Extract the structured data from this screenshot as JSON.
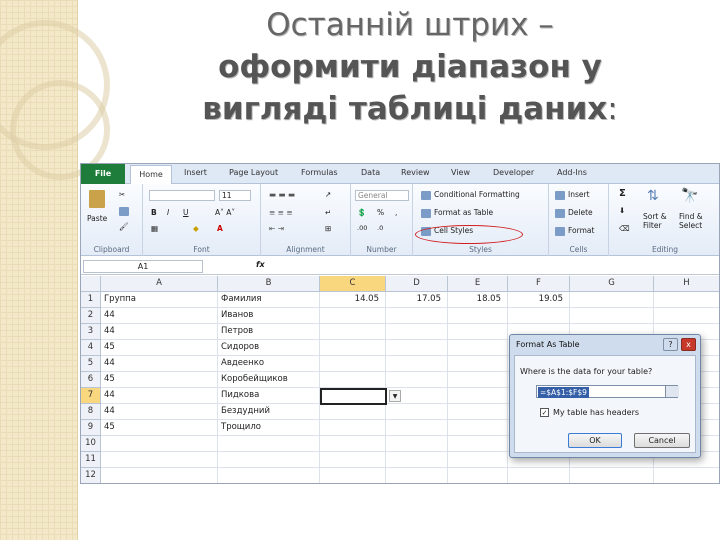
{
  "slide": {
    "title_line1": "Останній штрих –",
    "title_line2": "оформити діапазон у",
    "title_line3": "вигляді таблиці даних",
    "title_colon": ":"
  },
  "ribbon": {
    "tabs": [
      "File",
      "Home",
      "Insert",
      "Page Layout",
      "Formulas",
      "Data",
      "Review",
      "View",
      "Developer",
      "Add-Ins"
    ],
    "groups": [
      "Clipboard",
      "Font",
      "Alignment",
      "Number",
      "Styles",
      "Cells",
      "Editing"
    ],
    "paste": "Paste",
    "font_size": "11",
    "number_format": "General",
    "conditional_formatting": "Conditional Formatting",
    "format_as_table": "Format as Table",
    "cell_styles": "Cell Styles",
    "insert": "Insert",
    "delete": "Delete",
    "format": "Format",
    "sort_filter": "Sort & Filter",
    "find_select": "Find & Select",
    "sigma": "Σ",
    "percent": "%",
    "accent_oval": "#d02020"
  },
  "formula_bar": {
    "name_box": "A1",
    "fx": "fx"
  },
  "sheet": {
    "columns": [
      "A",
      "B",
      "C",
      "D",
      "E",
      "F",
      "G",
      "H"
    ],
    "row_numbers": [
      "1",
      "2",
      "3",
      "4",
      "5",
      "6",
      "7",
      "8",
      "9",
      "10",
      "11",
      "12"
    ],
    "header_row": [
      "Группа",
      "Фамилия",
      "14.05",
      "17.05",
      "18.05",
      "19.05"
    ],
    "rows": [
      [
        "44",
        "Иванов"
      ],
      [
        "44",
        "Петров"
      ],
      [
        "45",
        "Сидоров"
      ],
      [
        "44",
        "Авдеенко"
      ],
      [
        "45",
        "Коробейщиков"
      ],
      [
        "44",
        "Пидкова"
      ],
      [
        "44",
        "Бездудний"
      ],
      [
        "45",
        "Трощило"
      ]
    ]
  },
  "dialog": {
    "title": "Format As Table",
    "help": "?",
    "close": "x",
    "prompt": "Where is the data for your table?",
    "range": "=$A$1:$F$9",
    "checkbox_label": "My table has headers",
    "ok": "OK",
    "cancel": "Cancel"
  }
}
